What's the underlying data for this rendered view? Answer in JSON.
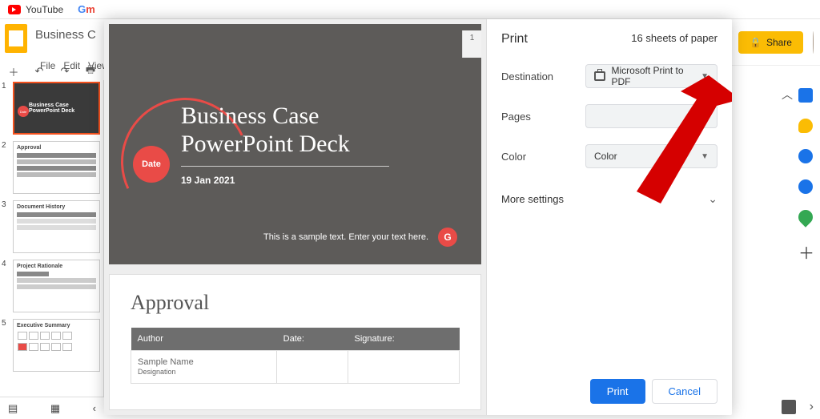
{
  "bookmarks": {
    "youtube": "YouTube",
    "gmail": "Gm"
  },
  "doc": {
    "title": "Business Cas",
    "menus": [
      "File",
      "Edit",
      "View"
    ]
  },
  "thumbs": [
    {
      "n": "1",
      "title_a": "Business Case",
      "title_b": "PowerPoint Deck"
    },
    {
      "n": "2",
      "title": "Approval"
    },
    {
      "n": "3",
      "title": "Document History"
    },
    {
      "n": "4",
      "title": "Project Rationale"
    },
    {
      "n": "5",
      "title": "Executive Summary"
    }
  ],
  "preview": {
    "slide1": {
      "title_a": "Business Case",
      "title_b": "PowerPoint Deck",
      "date_badge": "Date",
      "date": "19 Jan 2021",
      "footer": "This is a sample text. Enter your text here.",
      "g": "G",
      "page": "1"
    },
    "slide2": {
      "title": "Approval",
      "cols": [
        "Author",
        "Date:",
        "Signature:"
      ],
      "row": [
        "Sample Name",
        "",
        ""
      ],
      "row2": "Designation"
    }
  },
  "print": {
    "title": "Print",
    "sheets": "16 sheets of paper",
    "destination_label": "Destination",
    "destination_value": "Microsoft Print to PDF",
    "pages_label": "Pages",
    "pages_value": "",
    "color_label": "Color",
    "color_value": "Color",
    "more": "More settings",
    "print_btn": "Print",
    "cancel_btn": "Cancel"
  },
  "share": "Share"
}
